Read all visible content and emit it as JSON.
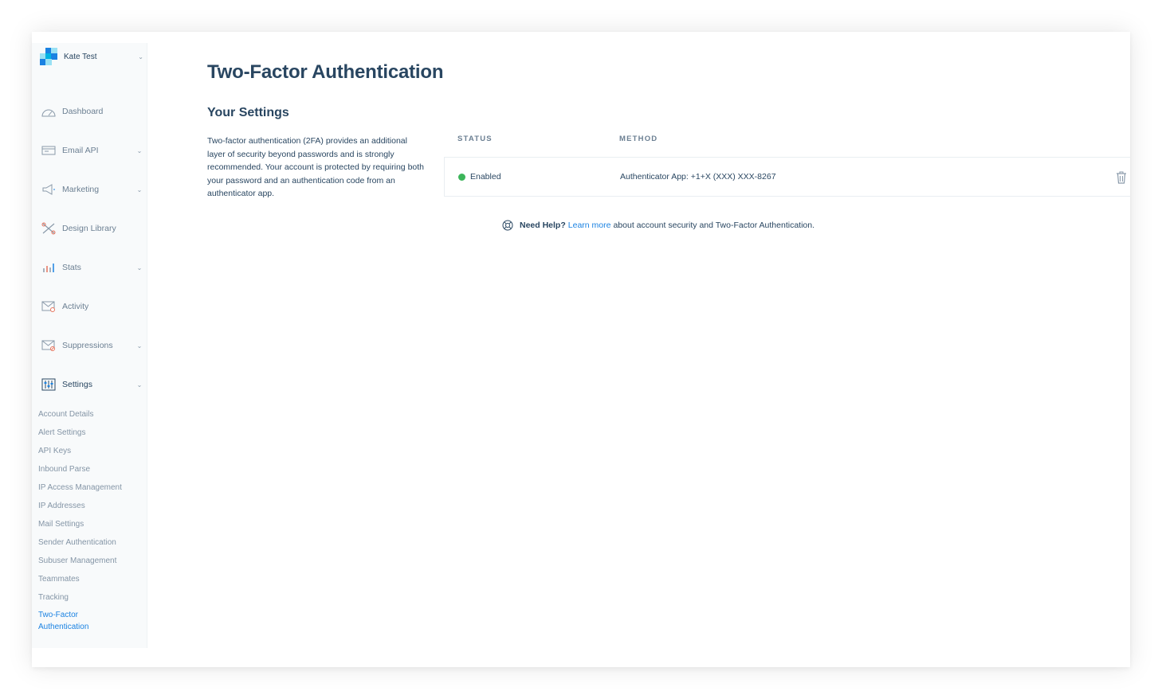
{
  "account": {
    "name": "Kate Test"
  },
  "sidebar": {
    "items": [
      {
        "label": "Dashboard",
        "icon": "dashboard-icon",
        "chevron": false
      },
      {
        "label": "Email API",
        "icon": "email-api-icon",
        "chevron": true
      },
      {
        "label": "Marketing",
        "icon": "megaphone-icon",
        "chevron": true
      },
      {
        "label": "Design Library",
        "icon": "design-library-icon",
        "chevron": false
      },
      {
        "label": "Stats",
        "icon": "stats-icon",
        "chevron": true
      },
      {
        "label": "Activity",
        "icon": "activity-icon",
        "chevron": false
      },
      {
        "label": "Suppressions",
        "icon": "suppressions-icon",
        "chevron": true
      },
      {
        "label": "Settings",
        "icon": "settings-icon",
        "chevron": true
      }
    ],
    "settings_subitems": [
      "Account Details",
      "Alert Settings",
      "API Keys",
      "Inbound Parse",
      "IP Access Management",
      "IP Addresses",
      "Mail Settings",
      "Sender Authentication",
      "Subuser Management",
      "Teammates",
      "Tracking",
      "Two-Factor Authentication"
    ]
  },
  "main": {
    "title": "Two-Factor Authentication",
    "section_title": "Your Settings",
    "description": "Two-factor authentication (2FA) provides an additional layer of security beyond passwords and is strongly recommended. Your account is protected by requiring both your password and an authentication code from an authenticator app.",
    "table": {
      "headers": {
        "status": "STATUS",
        "method": "METHOD"
      },
      "rows": [
        {
          "status": "Enabled",
          "method": "Authenticator App: +1+X (XXX) XXX-8267"
        }
      ]
    },
    "help": {
      "prefix": "Need Help?",
      "link": "Learn more",
      "suffix": "about account security and Two-Factor Authentication."
    }
  },
  "colors": {
    "brand_blue": "#1a82e2",
    "text_dark": "#294661",
    "status_green": "#3cb55a"
  }
}
